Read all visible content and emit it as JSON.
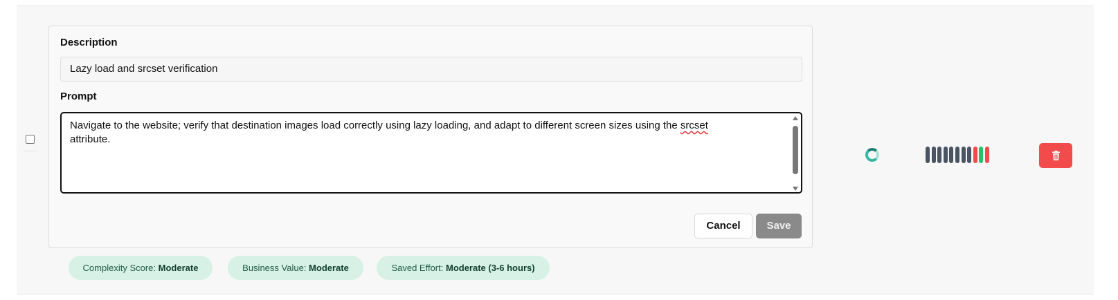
{
  "row": {
    "description_label": "Description",
    "description_value": "Lazy load and srcset verification",
    "prompt_label": "Prompt",
    "prompt_before": "Navigate to the website; verify that destination images load correctly using lazy loading, and adapt to different screen sizes using the ",
    "prompt_flagged_word": "srcset",
    "prompt_after": " attribute.",
    "cancel_label": "Cancel",
    "save_label": "Save",
    "tags": [
      {
        "label": "Complexity Score:",
        "value": "Moderate"
      },
      {
        "label": "Business Value:",
        "value": "Moderate"
      },
      {
        "label": "Saved Effort:",
        "value": "Moderate (3-6 hours)"
      }
    ],
    "status_icon": "spinner-icon",
    "run_history": [
      "gray",
      "gray",
      "gray",
      "gray",
      "gray",
      "gray",
      "gray",
      "gray",
      "red",
      "green",
      "red"
    ],
    "delete_icon": "trash-icon"
  },
  "colors": {
    "gray": "#4a5463",
    "red": "#f24b4b",
    "green": "#27c26a",
    "tag_bg": "#d7f1e6",
    "delete_bg": "#f24b4b",
    "accent": "#36b6a3"
  }
}
